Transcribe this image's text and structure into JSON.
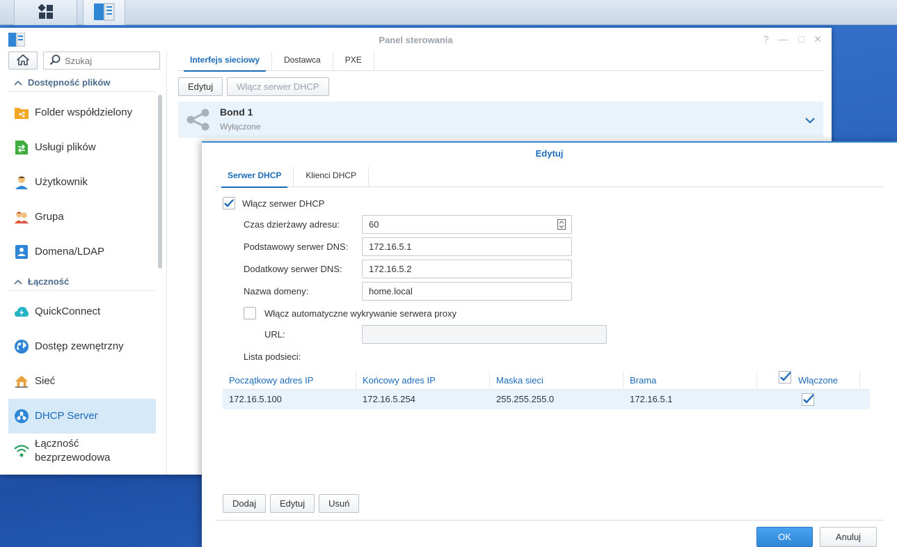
{
  "window": {
    "title": "Panel sterowania",
    "controls": [
      "?",
      "—",
      "□",
      "✕"
    ]
  },
  "sidebar": {
    "search_placeholder": "Szukaj",
    "sections": [
      {
        "label": "Dostępność plików"
      },
      {
        "label": "Łączność"
      }
    ],
    "items": [
      {
        "label": "Folder współdzielony",
        "icon": "shared-folder-icon"
      },
      {
        "label": "Usługi plików",
        "icon": "file-services-icon"
      },
      {
        "label": "Użytkownik",
        "icon": "user-icon"
      },
      {
        "label": "Grupa",
        "icon": "group-icon"
      },
      {
        "label": "Domena/LDAP",
        "icon": "domain-icon"
      },
      {
        "label": "QuickConnect",
        "icon": "quickconnect-icon"
      },
      {
        "label": "Dostęp zewnętrzny",
        "icon": "globe-icon"
      },
      {
        "label": "Sieć",
        "icon": "network-house-icon"
      },
      {
        "label": "DHCP Server",
        "icon": "dhcp-icon"
      },
      {
        "label_line1": "Łączność",
        "label_line2": "bezprzewodowa",
        "icon": "wifi-icon"
      }
    ]
  },
  "content": {
    "tabs": [
      "Interfejs sieciowy",
      "Dostawca",
      "PXE"
    ],
    "toolbar": {
      "edit": "Edytuj",
      "enable_dhcp": "Włącz serwer DHCP"
    },
    "bond": {
      "name": "Bond 1",
      "status": "Wyłączone"
    }
  },
  "dialog": {
    "title": "Edytuj",
    "tabs": [
      "Serwer DHCP",
      "Klienci DHCP"
    ],
    "enable_dhcp_label": "Włącz serwer DHCP",
    "enable_dhcp_checked": true,
    "lease_label": "Czas dzierżawy adresu:",
    "lease_value": "60",
    "dns1_label": "Podstawowy serwer DNS:",
    "dns1_value": "172.16.5.1",
    "dns2_label": "Dodatkowy serwer DNS:",
    "dns2_value": "172.16.5.2",
    "domain_label": "Nazwa domeny:",
    "domain_value": "home.local",
    "proxy_label": "Włącz automatyczne wykrywanie serwera proxy",
    "proxy_checked": false,
    "url_label": "URL:",
    "url_value": "",
    "subnet_list_label": "Lista podsieci:",
    "grid": {
      "headers": [
        "Początkowy adres IP",
        "Końcowy adres IP",
        "Maska sieci",
        "Brama",
        "Włączone"
      ],
      "rows": [
        {
          "start": "172.16.5.100",
          "end": "172.16.5.254",
          "mask": "255.255.255.0",
          "gateway": "172.16.5.1",
          "enabled": true
        }
      ]
    },
    "buttons": {
      "add": "Dodaj",
      "edit": "Edytuj",
      "delete": "Usuń",
      "ok": "OK",
      "cancel": "Anuluj"
    }
  },
  "colors": {
    "accent": "#1b6bb8",
    "selected_bg": "#d6e9f8",
    "primary_button": "#2f86d6"
  }
}
